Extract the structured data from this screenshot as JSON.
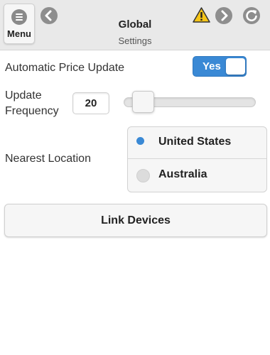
{
  "header": {
    "menu_label": "Menu",
    "title": "Global",
    "subtitle": "Settings",
    "icons": [
      "menu-icon",
      "back-arrow-icon",
      "warning-icon",
      "forward-arrow-icon",
      "refresh-icon"
    ]
  },
  "settings": {
    "auto_update": {
      "label": "Automatic Price Update",
      "toggle_label": "Yes",
      "enabled": true
    },
    "frequency": {
      "label_line1": "Update",
      "label_line2": "Frequency",
      "value": "20",
      "slider_fraction": 0.12
    },
    "location": {
      "label": "Nearest Location",
      "options": [
        "United States",
        "Australia"
      ],
      "selected": "United States"
    },
    "link_button": "Link Devices"
  },
  "colors": {
    "accent": "#3a89d5",
    "header_bg": "#e9e9e9",
    "warning": "#f5c518"
  }
}
